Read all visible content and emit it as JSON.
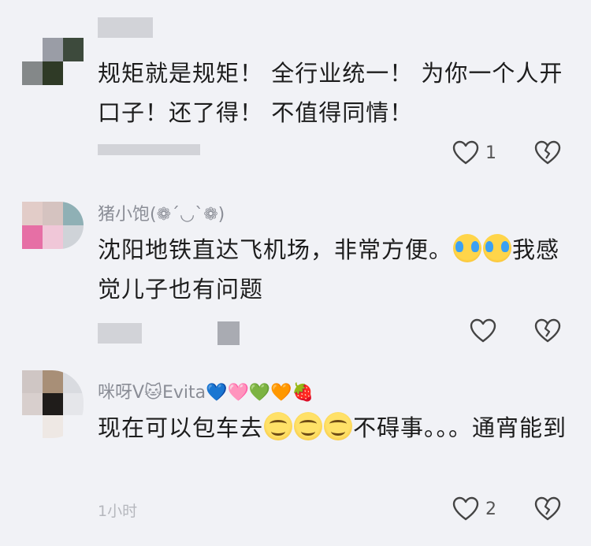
{
  "comments": [
    {
      "username": "",
      "text": "规矩就是规矩！ 全行业统一！ 为你一个人开口子！还了得！ 不值得同情！",
      "meta": "",
      "like_count": "1"
    },
    {
      "username": "猪小饱(❁´◡`❁)",
      "text_part1": "沈阳地铁直达飞机场，非常方便。",
      "text_part2": "我感觉儿子也有问题",
      "meta": "",
      "like_count": ""
    },
    {
      "username": "咪呀V🐱Evita💙🩷💚🧡🍓",
      "text_part1": "现在可以包车去",
      "text_part2": "不碍事。。。通宵能到",
      "meta": "1小时",
      "like_count": "2"
    }
  ],
  "icons": {
    "like": "heart-outline-icon",
    "dislike": "broken-heart-icon",
    "cry_emoji": "crying-laughing-emoji-icon",
    "smile_emoji": "smirk-emoji-icon"
  },
  "colors": {
    "background": "#f1f2f6",
    "username": "#8a8d96",
    "text": "#1d1d1d",
    "meta": "#b5b7bd",
    "icon": "#444444"
  }
}
